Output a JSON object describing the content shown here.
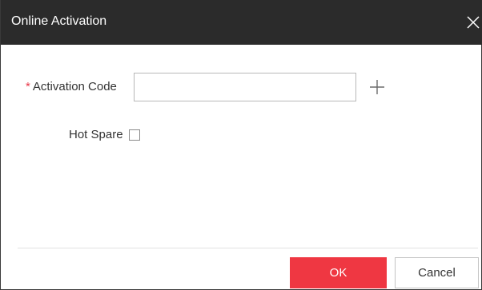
{
  "dialog": {
    "title": "Online Activation",
    "close_icon": "close-icon"
  },
  "form": {
    "activation_code": {
      "required_mark": "*",
      "label": "Activation Code",
      "value": "",
      "placeholder": "",
      "add_icon": "plus-icon"
    },
    "hot_spare": {
      "label": "Hot Spare",
      "checked": false
    }
  },
  "footer": {
    "ok_label": "OK",
    "cancel_label": "Cancel"
  },
  "colors": {
    "titlebar": "#2b2b2b",
    "primary": "#ef3742",
    "required": "#e8394a"
  }
}
